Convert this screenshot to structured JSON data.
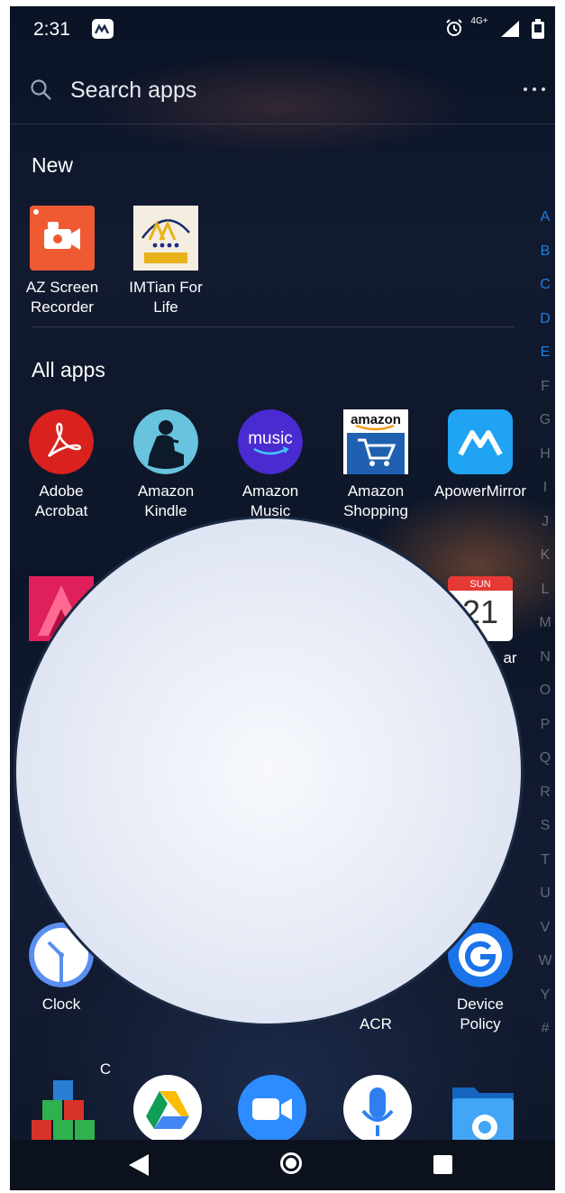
{
  "status_bar": {
    "time": "2:31",
    "network_label": "4G+",
    "icons": [
      "apowermirror-status-icon",
      "alarm-icon",
      "signal-icon",
      "battery-icon"
    ]
  },
  "search": {
    "placeholder": "Search apps",
    "more_icon": "more-dots-icon"
  },
  "sections": {
    "new_title": "New",
    "all_title": "All apps"
  },
  "new_apps": [
    {
      "label": "AZ Screen\nRecorder",
      "icon": "az-screen-recorder-icon"
    },
    {
      "label": "IMTian For\nLife",
      "icon": "imtian-icon",
      "icon_caption": "IMTian For Life"
    }
  ],
  "apps_row1": [
    {
      "label": "Adobe\nAcrobat",
      "icon": "adobe-acrobat-icon"
    },
    {
      "label": "Amazon\nKindle",
      "icon": "kindle-icon"
    },
    {
      "label": "Amazon\nMusic",
      "icon": "amazon-music-icon",
      "icon_text": "music"
    },
    {
      "label": "Amazon\nShopping",
      "icon": "amazon-shopping-icon",
      "icon_text": "amazon"
    },
    {
      "label": "ApowerMirror",
      "icon": "apowermirror-icon"
    }
  ],
  "apps_row2_partial": {
    "calendar_day": "SUN",
    "calendar_date_fragment": "21",
    "calendar_label_fragment": "ar"
  },
  "apps_row3_partial": [
    {
      "label": "Clock",
      "icon": "clock-icon"
    },
    {
      "label": "C",
      "icon": "hidden-icon"
    },
    {
      "label": "ACR",
      "icon": "hidden-icon"
    },
    {
      "label": "Device\nPolicy",
      "icon": "device-policy-icon"
    }
  ],
  "index_letters": [
    "A",
    "B",
    "C",
    "D",
    "E",
    "F",
    "G",
    "H",
    "I",
    "J",
    "K",
    "L",
    "M",
    "N",
    "O",
    "P",
    "Q",
    "R",
    "S",
    "T",
    "U",
    "V",
    "W",
    "Y",
    "#"
  ],
  "index_active_count": 5,
  "dock": [
    "cubes-app-icon",
    "google-drive-icon",
    "zoom-icon",
    "voice-recorder-icon",
    "file-explorer-icon"
  ],
  "navigation": [
    "back-button",
    "home-button",
    "recents-button"
  ],
  "colors": {
    "accent_blue": "#1e7ee8",
    "az_orange": "#ef5a33",
    "adobe_red": "#d9211d",
    "amazon_music_purple": "#4a2bd1",
    "apowermirror_blue": "#1fa3f2"
  }
}
